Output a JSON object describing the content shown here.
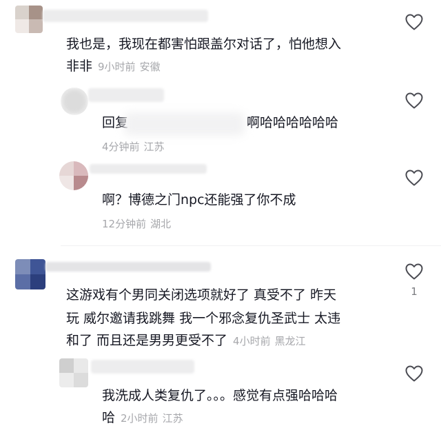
{
  "comments": [
    {
      "text_line1": "我也是，我现在都害怕跟盖尔对话了，怕他想入",
      "text_line2": "非非",
      "time": "9小时前",
      "location": "安徽",
      "like_count": "",
      "replies": [
        {
          "prefix": "回复",
          "text": "啊哈哈哈哈哈哈",
          "time": "4分钟前",
          "location": "江苏",
          "like_count": ""
        },
        {
          "text": "啊？博德之门npc还能强了你不成",
          "time": "12分钟前",
          "location": "湖北",
          "like_count": ""
        }
      ]
    },
    {
      "text_line1": "这游戏有个男同关闭选项就好了 真受不了 昨天",
      "text_line2": "玩 威尔邀请我跳舞 我一个邪念复仇圣武士 太违",
      "text_line3": "和了 而且还是男男更受不了",
      "time": "4小时前",
      "location": "黑龙江",
      "like_count": "1",
      "replies": [
        {
          "text_line1": "我洗成人类复仇了。。。感觉有点强哈哈哈",
          "text_line2": "哈",
          "time": "2小时前",
          "location": "江苏",
          "like_count": ""
        }
      ]
    }
  ],
  "icons": {
    "like": "heart-outline-icon"
  },
  "colors": {
    "text": "#161823",
    "meta": "#a6a7ab",
    "heart": "#4a4b52"
  }
}
